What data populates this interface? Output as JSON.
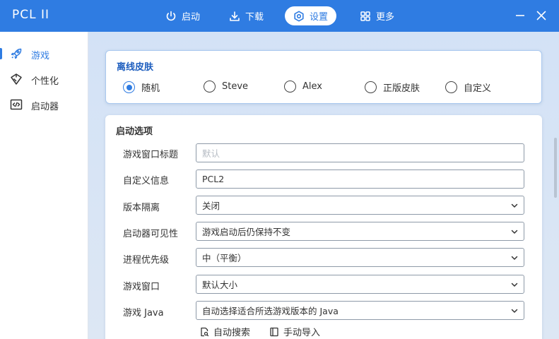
{
  "app": {
    "logo": "PCL II"
  },
  "nav": {
    "launch": "启动",
    "download": "下载",
    "settings": "设置",
    "more": "更多"
  },
  "sidebar": {
    "items": [
      {
        "label": "游戏",
        "icon": "rocket-icon",
        "active": true
      },
      {
        "label": "个性化",
        "icon": "brush-icon",
        "active": false
      },
      {
        "label": "启动器",
        "icon": "code-icon",
        "active": false
      }
    ]
  },
  "skin": {
    "title": "离线皮肤",
    "options": [
      "随机",
      "Steve",
      "Alex",
      "正版皮肤",
      "自定义"
    ],
    "selected": "随机"
  },
  "launch": {
    "title": "启动选项",
    "rows": [
      {
        "label": "游戏窗口标题",
        "value": "",
        "placeholder": "默认",
        "type": "text"
      },
      {
        "label": "自定义信息",
        "value": "PCL2",
        "placeholder": "",
        "type": "text"
      },
      {
        "label": "版本隔离",
        "value": "关闭",
        "type": "select"
      },
      {
        "label": "启动器可见性",
        "value": "游戏启动后仍保持不变",
        "type": "select"
      },
      {
        "label": "进程优先级",
        "value": "中（平衡）",
        "type": "select"
      },
      {
        "label": "游戏窗口",
        "value": "默认大小",
        "type": "select"
      },
      {
        "label": "游戏 Java",
        "value": "自动选择适合所选游戏版本的 Java",
        "type": "select"
      }
    ],
    "auto_search": "自动搜索",
    "manual_import": "手动导入"
  },
  "colors": {
    "accent": "#2f7ce2",
    "titlebar": "#2f7ce2"
  }
}
